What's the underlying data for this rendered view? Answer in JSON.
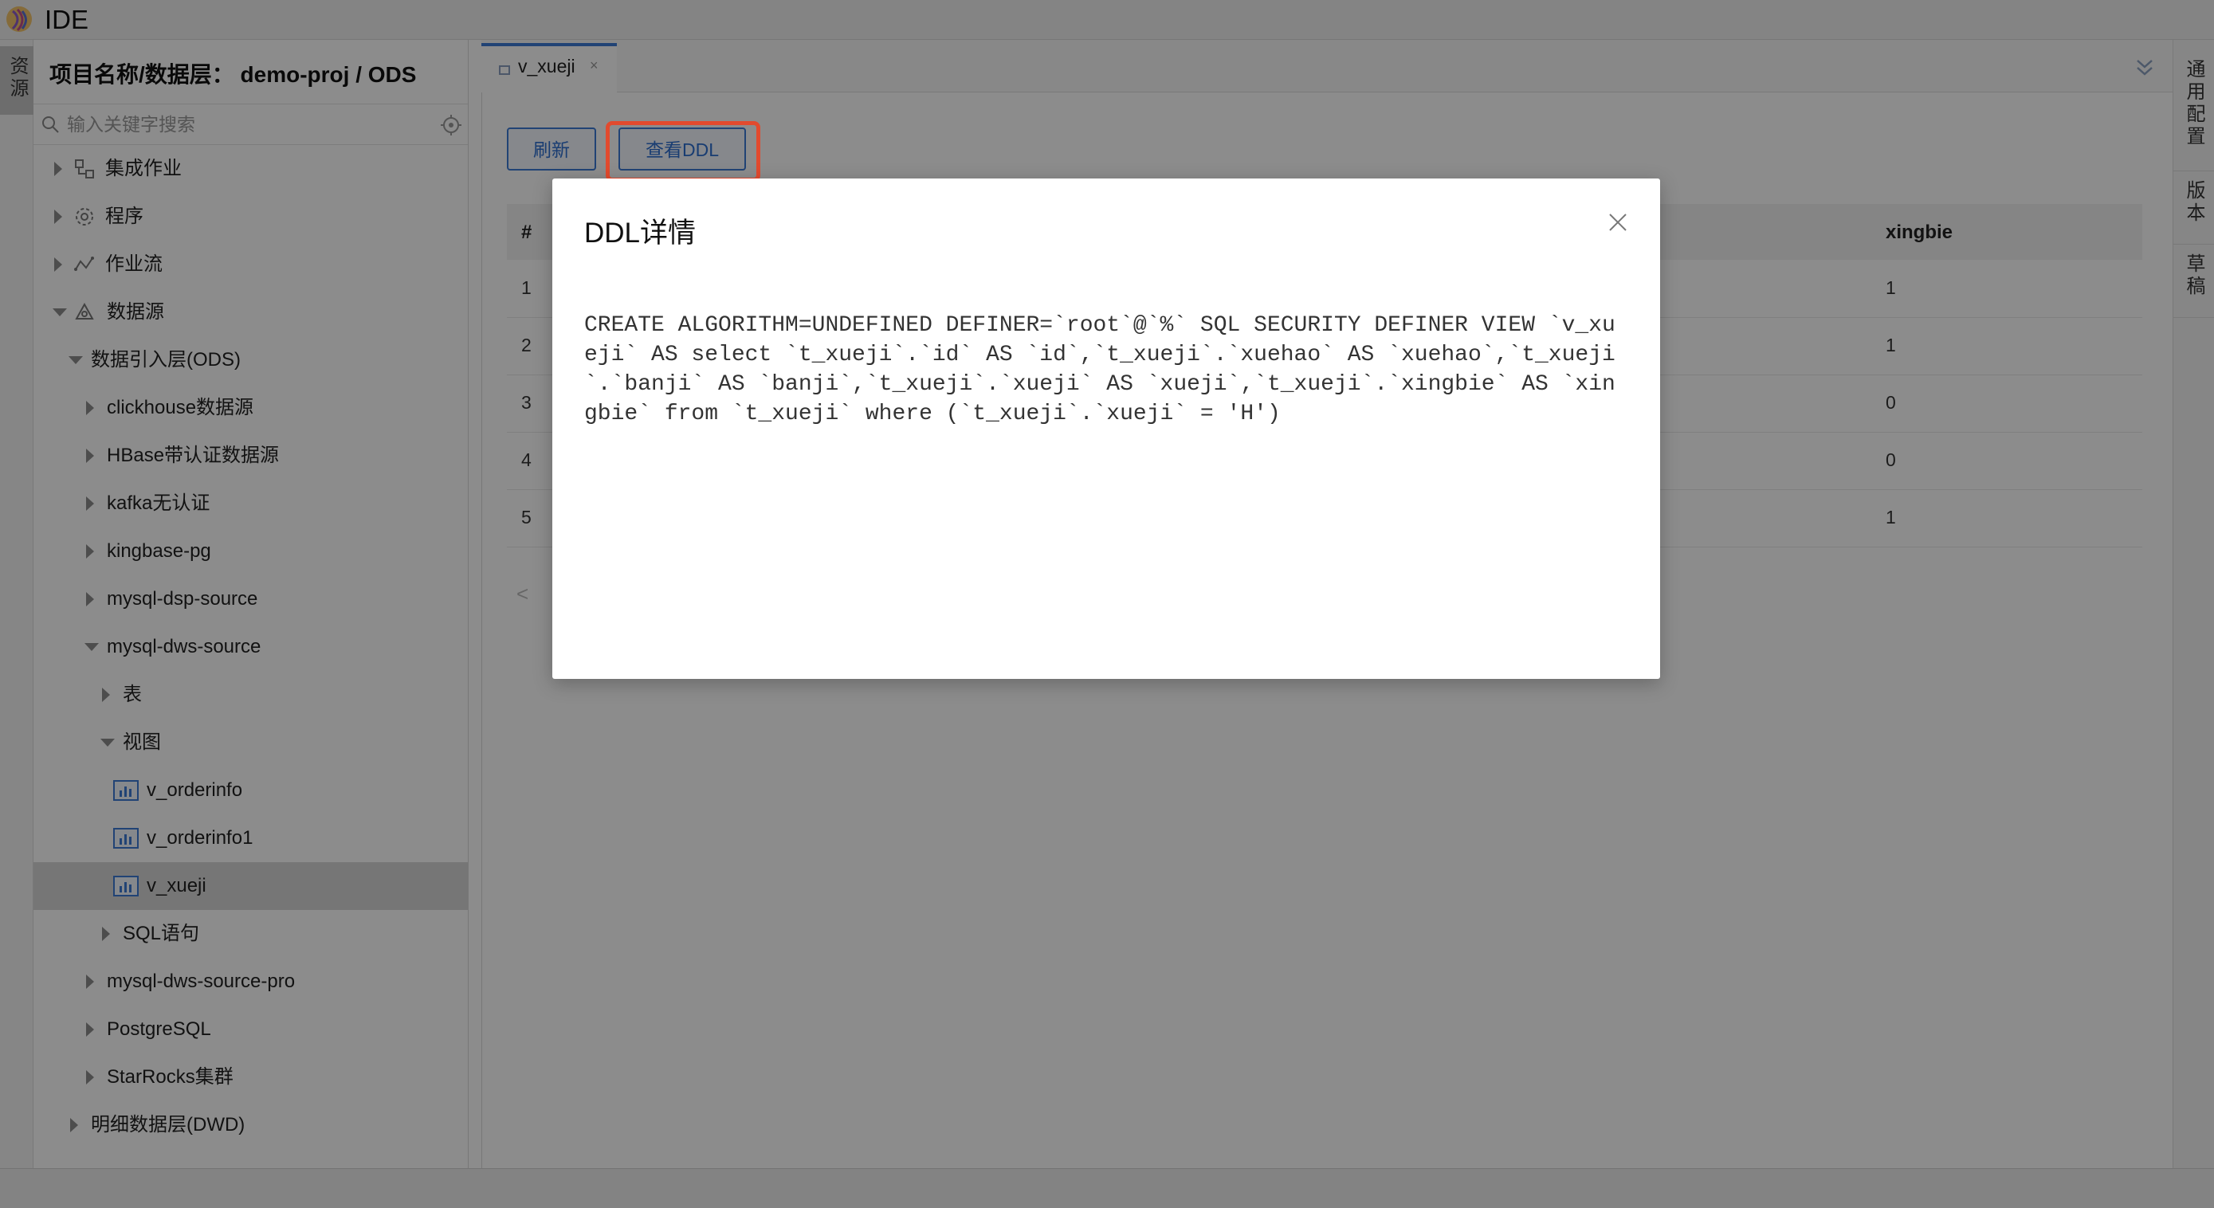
{
  "app": {
    "title": "IDE"
  },
  "left_strip": {
    "label": "资源"
  },
  "sidebar": {
    "project_title": "项目名称/数据层： demo-proj / ODS",
    "search_placeholder": "输入关键字搜索",
    "tree": [
      {
        "label": "集成作业",
        "icon": "integration-icon",
        "expanded": false
      },
      {
        "label": "程序",
        "icon": "gear-icon",
        "expanded": false
      },
      {
        "label": "作业流",
        "icon": "workflow-icon",
        "expanded": false
      },
      {
        "label": "数据源",
        "icon": "datasource-icon",
        "expanded": true
      },
      {
        "label": "数据引入层(ODS)",
        "expanded": true
      },
      {
        "label": "clickhouse数据源",
        "expanded": false
      },
      {
        "label": "HBase带认证数据源",
        "expanded": false
      },
      {
        "label": "kafka无认证",
        "expanded": false
      },
      {
        "label": "kingbase-pg",
        "expanded": false
      },
      {
        "label": "mysql-dsp-source",
        "expanded": false
      },
      {
        "label": "mysql-dws-source",
        "expanded": true
      },
      {
        "label": "表",
        "expanded": false
      },
      {
        "label": "视图",
        "expanded": true
      },
      {
        "label": "v_orderinfo",
        "icon": "view-icon"
      },
      {
        "label": "v_orderinfo1",
        "icon": "view-icon"
      },
      {
        "label": "v_xueji",
        "icon": "view-icon",
        "selected": true
      },
      {
        "label": "SQL语句",
        "expanded": false
      },
      {
        "label": "mysql-dws-source-pro",
        "expanded": false
      },
      {
        "label": "PostgreSQL",
        "expanded": false
      },
      {
        "label": "StarRocks集群",
        "expanded": false
      },
      {
        "label": "明细数据层(DWD)",
        "expanded": false
      }
    ]
  },
  "editor": {
    "tab_label": "v_xueji",
    "tab_close": "×",
    "refresh_label": "刷新",
    "view_ddl_label": "查看DDL",
    "table": {
      "headers": [
        "#",
        "xingbie"
      ],
      "rows": [
        {
          "index": "1",
          "xingbie": "1"
        },
        {
          "index": "2",
          "xingbie": "1"
        },
        {
          "index": "3",
          "xingbie": "0"
        },
        {
          "index": "4",
          "xingbie": "0"
        },
        {
          "index": "5",
          "xingbie": "1"
        }
      ],
      "pager_prev": "<"
    }
  },
  "right_strip": {
    "tabs": [
      "通用配置",
      "版本",
      "草稿"
    ]
  },
  "modal": {
    "title": "DDL详情",
    "ddl": "CREATE ALGORITHM=UNDEFINED DEFINER=`root`@`%` SQL SECURITY DEFINER VIEW `v_xueji` AS select `t_xueji`.`id` AS `id`,`t_xueji`.`xuehao` AS `xuehao`,`t_xueji`.`banji` AS `banji`,`t_xueji`.`xueji` AS `xueji`,`t_xueji`.`xingbie` AS `xingbie` from `t_xueji` where (`t_xueji`.`xueji` = 'H')"
  },
  "colors": {
    "accent": "#3d7bd6",
    "highlight": "#e24a2e"
  }
}
